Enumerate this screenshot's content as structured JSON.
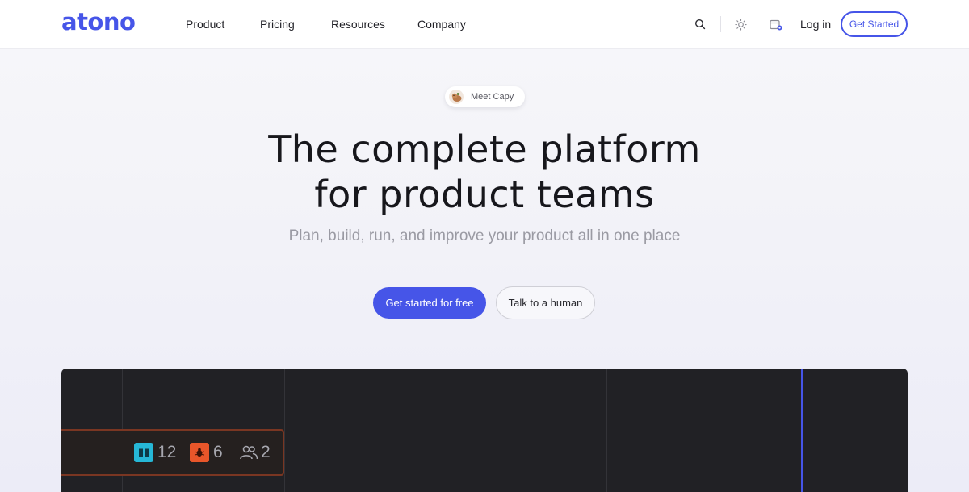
{
  "brand": {
    "logo_text": "atono",
    "accent": "#4655e8"
  },
  "nav": {
    "links": [
      {
        "label": "Product"
      },
      {
        "label": "Pricing"
      },
      {
        "label": "Resources"
      },
      {
        "label": "Company"
      }
    ],
    "icons": [
      "search-icon",
      "sun-icon",
      "calendar-icon"
    ],
    "login_label": "Log in",
    "cta_label": "Get Started"
  },
  "hero": {
    "badge_label": "Meet Capy",
    "title_line1": "The complete platform",
    "title_line2": "for product teams",
    "subtitle": "Plan, build, run, and improve your product all in one place",
    "primary_cta": "Get started for free",
    "secondary_cta": "Talk to a human"
  },
  "preview": {
    "stats": [
      {
        "icon": "book-icon",
        "value": "12",
        "color": "#26b7d6"
      },
      {
        "icon": "bug-icon",
        "value": "6",
        "color": "#e8562a"
      },
      {
        "icon": "users-icon",
        "value": "2",
        "color": "#a8a8b0"
      }
    ]
  }
}
